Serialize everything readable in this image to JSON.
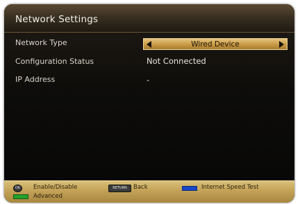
{
  "window": {
    "title": "Network Settings"
  },
  "settings": [
    {
      "label": "Network Type",
      "value": "Wired Device"
    },
    {
      "label": "Configuration Status",
      "value": "Not Connected"
    },
    {
      "label": "IP Address",
      "value": "-"
    }
  ],
  "footer": {
    "ok_key_label": "OK",
    "enable_disable": "Enable/Disable",
    "return_key_label": "RETURN",
    "back": "Back",
    "internet_speed_test": "Internet Speed Test",
    "advanced": "Advanced"
  },
  "colors": {
    "accent_gold": "#c99a45",
    "blue_key": "#1846c6",
    "green_key": "#25a12b"
  }
}
